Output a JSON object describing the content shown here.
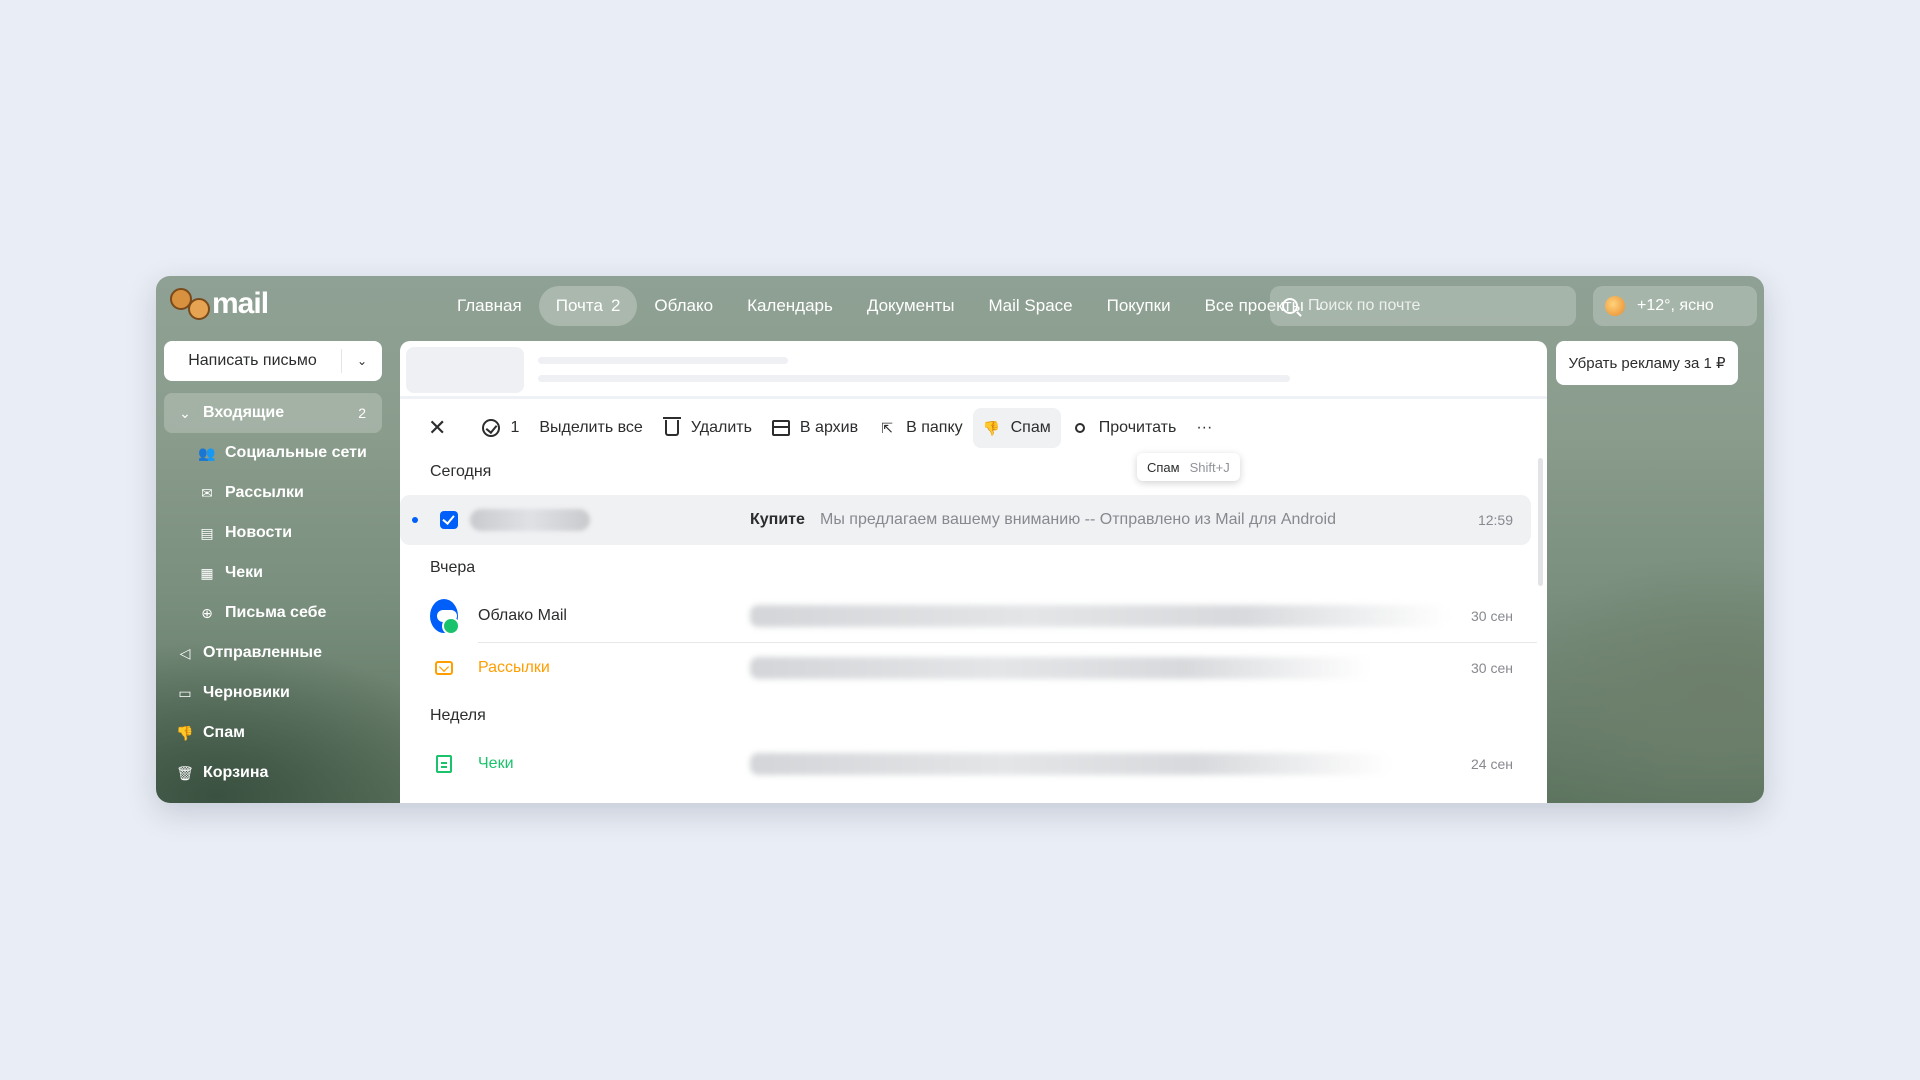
{
  "header": {
    "logo_text": "mail",
    "nav": [
      {
        "label": "Главная",
        "count": ""
      },
      {
        "label": "Почта",
        "count": "2"
      },
      {
        "label": "Облако",
        "count": ""
      },
      {
        "label": "Календарь",
        "count": ""
      },
      {
        "label": "Документы",
        "count": ""
      },
      {
        "label": "Mail Space",
        "count": ""
      },
      {
        "label": "Покупки",
        "count": ""
      },
      {
        "label": "Все проекты",
        "count": ""
      }
    ],
    "search_placeholder": "Поиск по почте",
    "weather": "+12°, ясно"
  },
  "compose": {
    "label": "Написать письмо"
  },
  "folders": [
    {
      "label": "Входящие",
      "badge": "2"
    },
    {
      "label": "Социальные сети"
    },
    {
      "label": "Рассылки"
    },
    {
      "label": "Новости"
    },
    {
      "label": "Чеки"
    },
    {
      "label": "Письма себе"
    },
    {
      "label": "Отправленные"
    },
    {
      "label": "Черновики"
    },
    {
      "label": "Спам"
    },
    {
      "label": "Корзина"
    }
  ],
  "toolbar": {
    "selected_count": "1",
    "select_all": "Выделить все",
    "delete": "Удалить",
    "archive": "В архив",
    "move": "В папку",
    "spam": "Спам",
    "read": "Прочитать",
    "more": "···"
  },
  "tooltip": {
    "label": "Спам",
    "shortcut": "Shift+J"
  },
  "groups": {
    "today": "Сегодня",
    "yesterday": "Вчера",
    "week": "Неделя"
  },
  "messages": [
    {
      "subject": "Купите",
      "snippet": "Мы предлагаем вашему вниманию -- Отправлено из Mail для Android",
      "time": "12:59"
    },
    {
      "sender": "Облако Mail",
      "time": "30 сен"
    },
    {
      "sender": "Рассылки",
      "time": "30 сен"
    },
    {
      "sender": "Чеки",
      "time": "24 сен"
    }
  ],
  "remove_ad": "Убрать рекламу за 1 ₽",
  "colors": {
    "accent": "#005ff9",
    "orange": "#ff9e00",
    "green": "#1ac36b"
  }
}
